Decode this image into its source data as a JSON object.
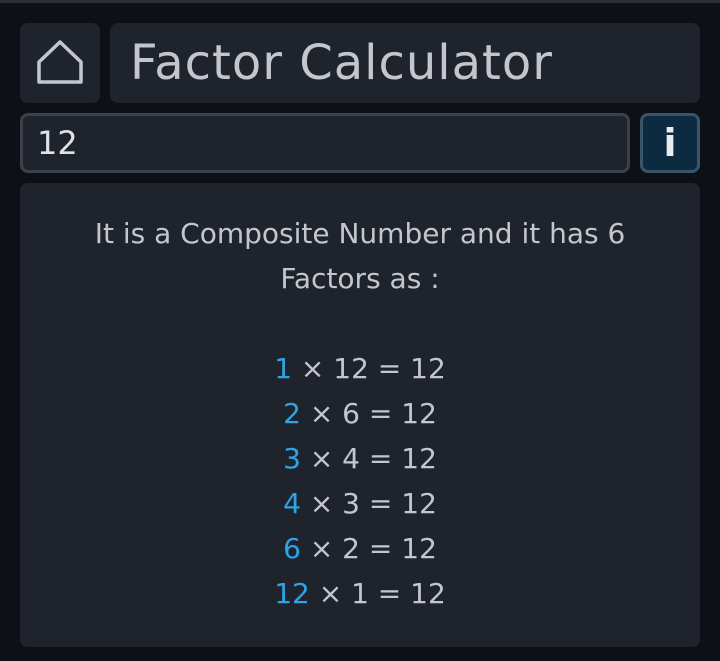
{
  "app": {
    "title": "Factor Calculator"
  },
  "icons": {
    "home": "home-icon",
    "info": "info-icon"
  },
  "input": {
    "value": "12"
  },
  "info_button": {
    "label": "i"
  },
  "result": {
    "summary": "It is a Composite Number and it has 6 Factors as :",
    "pairs": [
      {
        "factor": "1",
        "rest": " × 12 = 12"
      },
      {
        "factor": "2",
        "rest": " × 6 = 12"
      },
      {
        "factor": "3",
        "rest": " × 4 = 12"
      },
      {
        "factor": "4",
        "rest": " × 3 = 12"
      },
      {
        "factor": "6",
        "rest": " × 2 = 12"
      },
      {
        "factor": "12",
        "rest": " × 1 = 12"
      }
    ]
  },
  "colors": {
    "background": "#0d1117",
    "panel": "#1f242c",
    "text": "#c3c7cd",
    "accent": "#2ea3e6",
    "info_button_bg": "#0c2b40"
  }
}
